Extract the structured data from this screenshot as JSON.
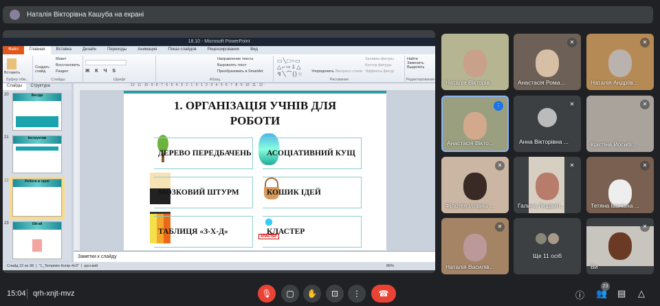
{
  "banner": {
    "text": "Наталія Вікторівна Кашуба на екрані"
  },
  "ppt": {
    "title": "18.10 - Microsoft PowerPoint",
    "tabs": [
      "Файл",
      "Главная",
      "Вставка",
      "Дизайн",
      "Переходы",
      "Анимация",
      "Показ слайдов",
      "Рецензирование",
      "Вид"
    ],
    "ribbon": {
      "clipboard": {
        "paste": "Вставить",
        "label": "Буфер обм..."
      },
      "slides": {
        "create": "Создать слайд",
        "layout": "Макет",
        "reset": "Восстановить",
        "section": "Раздел",
        "label": "Слайды"
      },
      "font": {
        "label": "Шрифт"
      },
      "paragraph": {
        "label": "Абзац",
        "dir": "Направление текста",
        "align": "Выровнять текст",
        "smartart": "Преобразовать в SmartArt"
      },
      "drawing": {
        "arrange": "Упорядочить",
        "styles": "Экспресс-стили",
        "fill": "Заливка фигуры",
        "outline": "Контур фигуры",
        "effects": "Эффекты фигур",
        "label": "Рисование"
      },
      "editing": {
        "find": "Найти",
        "replace": "Заменить",
        "select": "Выделить",
        "label": "Редактирование"
      }
    },
    "panel_tabs": [
      "Слайды",
      "Структура"
    ],
    "thumbnails": [
      {
        "num": "20",
        "title": "Бесіда"
      },
      {
        "num": "21",
        "title": "Інструктаж"
      },
      {
        "num": "22",
        "title": "Робота в групі"
      },
      {
        "num": "23",
        "title": "Ой-ой"
      }
    ],
    "slide": {
      "title": "1. ОРГАНІЗАЦІЯ  УЧНІВ ДЛЯ РОБОТИ",
      "items": [
        "ДЕРЕВО ПЕРЕДБАЧЕНЬ",
        "АСОЦІАТИВНИЙ КУЩ",
        "МОЗКОВИЙ ШТУРМ",
        "КОШИК ІДЕЙ",
        "ТАБЛИЦЯ «З-Х-Д»",
        "КЛАСТЕР"
      ],
      "cluster_caption": "КЛАСТЕР"
    },
    "notes_placeholder": "Заметки к слайду",
    "status": {
      "slide": "Слайд 22 из 38",
      "theme": "\"1_Template-Копір-4x3\"",
      "lang": "русский",
      "zoom": "86%"
    }
  },
  "participants": [
    {
      "name": "Наталія Вікторів...",
      "muted": false
    },
    {
      "name": "Анастасія Рома...",
      "muted": true
    },
    {
      "name": "Наталія Андріїв...",
      "muted": true
    },
    {
      "name": "Анастасія Вікто...",
      "muted": false,
      "speaking": true
    },
    {
      "name": "Анна Вікторівна ...",
      "muted": true
    },
    {
      "name": "Крістіна Йосипі...",
      "muted": true
    },
    {
      "name": "Філотея Іллівна ...",
      "muted": true
    },
    {
      "name": "Галина Людвигі...",
      "muted": true
    },
    {
      "name": "Тетяна Іванівна ...",
      "muted": true
    },
    {
      "name": "Наталія Василів...",
      "muted": true
    },
    {
      "name": "Ще 11 осіб"
    },
    {
      "name": "Ви",
      "muted": true
    }
  ],
  "bottom": {
    "time": "15:04",
    "meeting_code": "qrh-xnjt-mvz",
    "participant_count": "23"
  },
  "colors": {
    "end_call": "#ea4335",
    "accent": "#8ab4f8",
    "teal": "#2a9aa5"
  }
}
